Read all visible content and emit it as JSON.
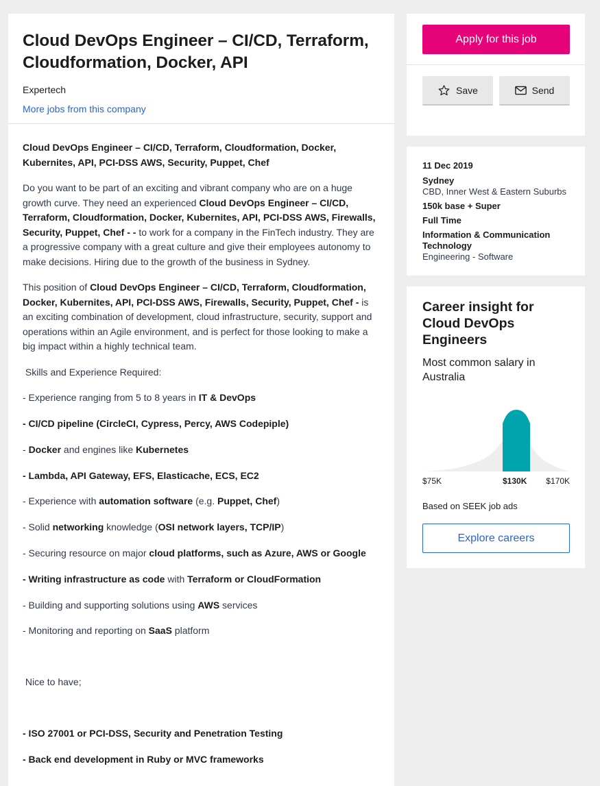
{
  "job": {
    "title": "Cloud DevOps Engineer – CI/CD, Terraform, Cloudformation, Docker, API",
    "company": "Expertech",
    "more_jobs_link": "More jobs from this company"
  },
  "description": {
    "intro_heading": "Cloud DevOps Engineer – CI/CD, Terraform, Cloudformation, Docker, Kubernites, API, PCI-DSS AWS, Security, Puppet, Chef",
    "p1_a": "Do you want to be part of an exciting and vibrant company who are on a huge growth curve. They need an experienced ",
    "p1_b": "Cloud DevOps Engineer – CI/CD, Terraform, Cloudformation, Docker, Kubernites, API, PCI-DSS AWS, Firewalls, Security, Puppet, Chef -  -",
    "p1_c": " to work for a company in the FinTech industry. They are a progressive company with a great culture and give their employees autonomy to make decisions. Hiring due to the growth of the business in Sydney.",
    "p2_a": "This position of ",
    "p2_b": "Cloud DevOps Engineer – CI/CD, Terraform, Cloudformation, Docker, Kubernites, API, PCI-DSS AWS, Firewalls, Security, Puppet, Chef -",
    "p2_c": " is an exciting combination of development, cloud infrastructure, security, support and operations within an Agile environment, and is perfect for those looking to make a big impact within a highly technical team.",
    "skills_heading": " Skills and Experience Required:",
    "s1_a": "- Experience ranging from 5 to 8 years in ",
    "s1_b": "IT & DevOps",
    "s2_b": "- CI/CD pipeline (CircleCI, Cypress, Percy, AWS Codepiple)",
    "s3_a": "- ",
    "s3_b": "Docker",
    "s3_c": " and engines like ",
    "s3_d": "Kubernetes",
    "s4_b": "- Lambda, API Gateway, EFS, Elasticache, ECS, EC2",
    "s5_a": "- Experience with ",
    "s5_b": "automation software",
    "s5_c": " (e.g. ",
    "s5_d": "Puppet, Chef",
    "s5_e": ")",
    "s6_a": "- Solid ",
    "s6_b": "networking",
    "s6_c": " knowledge (",
    "s6_d": "OSI network layers, TCP/IP",
    "s6_e": ")",
    "s7_a": "- Securing resource on major ",
    "s7_b": "cloud platforms, such as Azure, AWS or Google",
    "s8_b": "- Writing infrastructure as code",
    "s8_c": " with ",
    "s8_d": "Terraform or CloudFormation",
    "s9_a": "- Building and supporting solutions using ",
    "s9_b": "AWS",
    "s9_c": " services",
    "s10_a": "- Monitoring and reporting on ",
    "s10_b": "SaaS",
    "s10_c": " platform",
    "nice_heading": " Nice to have;",
    "n1": "- ISO 27001 or PCI-DSS, Security and Penetration Testing",
    "n2": "- Back end development in Ruby or MVC frameworks"
  },
  "actions": {
    "apply_label": "Apply for this job",
    "save_label": "Save",
    "send_label": "Send",
    "apply_color": "#e60278"
  },
  "info": {
    "date": "11 Dec 2019",
    "location": "Sydney",
    "area": "CBD, Inner West & Eastern Suburbs",
    "salary": "150k base + Super",
    "work_type": "Full Time",
    "classification": "Information & Communication Technology",
    "sub_classification": "Engineering - Software"
  },
  "career": {
    "title": "Career insight for Cloud DevOps Engineers",
    "subtitle": "Most common salary in Australia",
    "salary_low": "$75K",
    "salary_mid": "$130K",
    "salary_high": "$170K",
    "based_on": "Based on SEEK job ads",
    "explore_label": "Explore careers",
    "highlight_color": "#00a4ad"
  }
}
